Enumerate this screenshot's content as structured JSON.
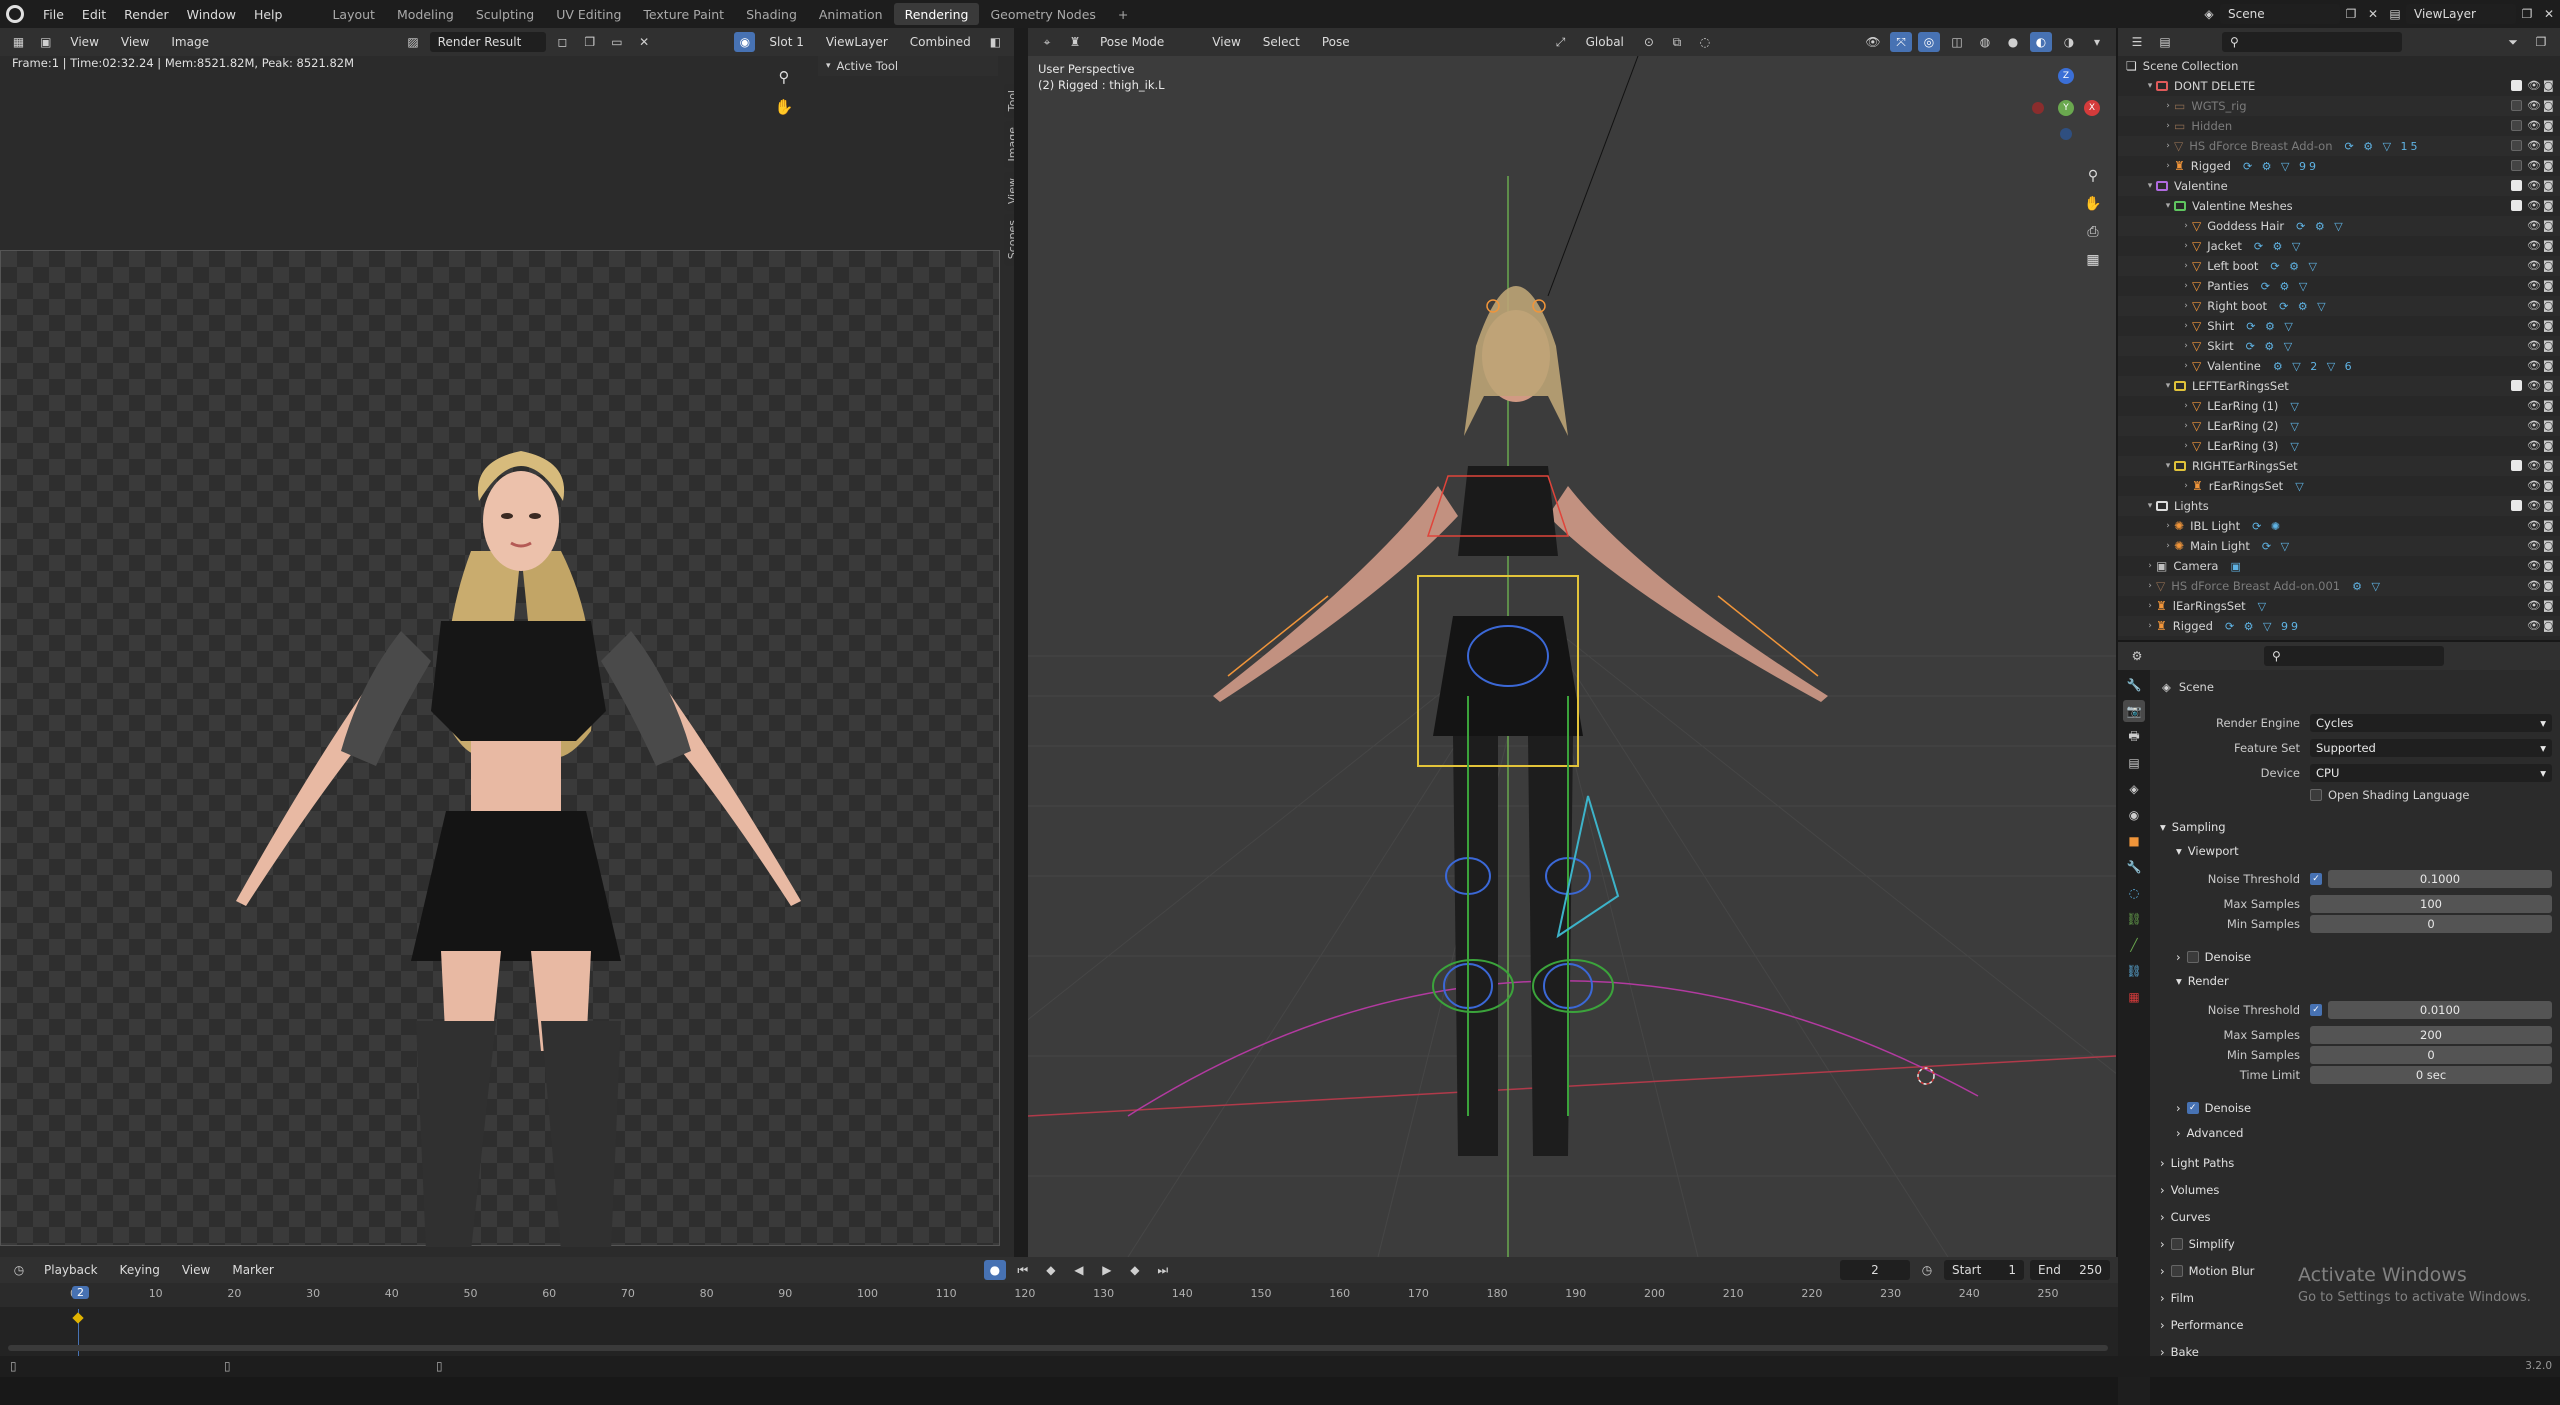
{
  "topbar": {
    "menus": [
      "File",
      "Edit",
      "Render",
      "Window",
      "Help"
    ],
    "workspaces": [
      "Layout",
      "Modeling",
      "Sculpting",
      "UV Editing",
      "Texture Paint",
      "Shading",
      "Animation",
      "Rendering",
      "Geometry Nodes"
    ],
    "active_workspace": "Rendering",
    "add_tab": "+",
    "scene": "Scene",
    "view_layer": "ViewLayer"
  },
  "image_editor": {
    "view": "View",
    "view2": "View",
    "image": "Image",
    "render_result": "Render Result",
    "slot": "Slot 1",
    "layer": "ViewLayer",
    "pass": "Combined",
    "info": "Frame:1 | Time:02:32.24 | Mem:8521.82M, Peak: 8521.82M",
    "active_tool": "Active Tool",
    "side_tabs": [
      "Tool",
      "Image",
      "View",
      "Scopes"
    ]
  },
  "viewport": {
    "mode": "Pose Mode",
    "menus": [
      "View",
      "Select",
      "Pose"
    ],
    "orientation": "Global",
    "overlay_title": "User Perspective",
    "overlay_sub": "(2) Rigged : thigh_ik.L",
    "gizmo_z": "Z",
    "gizmo_y": "Y",
    "gizmo_x": "X"
  },
  "outliner": {
    "search_placeholder": "",
    "root": "Scene Collection",
    "rows": [
      {
        "indent": 1,
        "label": "DONT DELETE",
        "type": "coll-red",
        "check": true
      },
      {
        "indent": 2,
        "label": "WGTS_rig",
        "type": "dim",
        "check": false
      },
      {
        "indent": 2,
        "label": "Hidden",
        "type": "dim",
        "check": false
      },
      {
        "indent": 2,
        "label": "HS dForce Breast Add-on",
        "type": "dim-mesh",
        "check": false,
        "mods": "⟳ ⚙ ▽ 15"
      },
      {
        "indent": 2,
        "label": "Rigged",
        "type": "armature",
        "check": false,
        "mods": "⟳ ⚙ ▽ 99"
      },
      {
        "indent": 1,
        "label": "Valentine",
        "type": "coll-purple",
        "check": true
      },
      {
        "indent": 2,
        "label": "Valentine  Meshes",
        "type": "coll-green",
        "check": true
      },
      {
        "indent": 3,
        "label": "Goddess Hair",
        "type": "mesh",
        "mods": "⟳ ⚙ ▽"
      },
      {
        "indent": 3,
        "label": "Jacket",
        "type": "mesh",
        "mods": "⟳ ⚙ ▽"
      },
      {
        "indent": 3,
        "label": "Left boot",
        "type": "mesh",
        "mods": "⟳ ⚙ ▽"
      },
      {
        "indent": 3,
        "label": "Panties",
        "type": "mesh",
        "mods": "⟳ ⚙ ▽"
      },
      {
        "indent": 3,
        "label": "Right boot",
        "type": "mesh",
        "mods": "⟳ ⚙ ▽"
      },
      {
        "indent": 3,
        "label": "Shirt",
        "type": "mesh",
        "mods": "⟳ ⚙ ▽"
      },
      {
        "indent": 3,
        "label": "Skirt",
        "type": "mesh",
        "mods": "⟳ ⚙ ▽"
      },
      {
        "indent": 3,
        "label": "Valentine",
        "type": "mesh",
        "mods": "⚙ ▽ 2 ▽ 6"
      },
      {
        "indent": 2,
        "label": "LEFTEarRingsSet",
        "type": "coll-yellow",
        "check": true
      },
      {
        "indent": 3,
        "label": "LEarRing (1)",
        "type": "mesh",
        "mods": "▽"
      },
      {
        "indent": 3,
        "label": "LEarRing (2)",
        "type": "mesh",
        "mods": "▽"
      },
      {
        "indent": 3,
        "label": "LEarRing (3)",
        "type": "mesh",
        "mods": "▽"
      },
      {
        "indent": 2,
        "label": "RIGHTEarRingsSet",
        "type": "coll-yellow",
        "check": true
      },
      {
        "indent": 3,
        "label": "rEarRingsSet",
        "type": "armature",
        "mods": "▽"
      },
      {
        "indent": 1,
        "label": "Lights",
        "type": "coll-white",
        "check": true
      },
      {
        "indent": 2,
        "label": "IBL Light",
        "type": "light",
        "mods": "⟳ ✺"
      },
      {
        "indent": 2,
        "label": "Main Light",
        "type": "light",
        "mods": "⟳ ▽"
      },
      {
        "indent": 1,
        "label": "Camera",
        "type": "camera",
        "mods": "▣"
      },
      {
        "indent": 1,
        "label": "HS dForce Breast Add-on.001",
        "type": "dim-mesh",
        "mods": "⚙ ▽"
      },
      {
        "indent": 1,
        "label": "lEarRingsSet",
        "type": "armature",
        "mods": "▽"
      },
      {
        "indent": 1,
        "label": "Rigged",
        "type": "armature",
        "mods": "⟳ ⚙ ▽ 99"
      }
    ]
  },
  "properties": {
    "breadcrumb": "Scene",
    "render_engine_label": "Render Engine",
    "render_engine": "Cycles",
    "feature_set_label": "Feature Set",
    "feature_set": "Supported",
    "device_label": "Device",
    "device": "CPU",
    "osl_label": "Open Shading Language",
    "sampling": "Sampling",
    "viewport": "Viewport",
    "noise_threshold_label": "Noise Threshold",
    "vp_noise": "0.1000",
    "max_samples_label": "Max Samples",
    "vp_max": "100",
    "min_samples_label": "Min Samples",
    "vp_min": "0",
    "denoise": "Denoise",
    "render": "Render",
    "r_noise": "0.0100",
    "r_max": "200",
    "r_min": "0",
    "time_limit_label": "Time Limit",
    "time_limit": "0 sec",
    "denoise2": "Denoise",
    "advanced": "Advanced",
    "panels": [
      "Light Paths",
      "Volumes",
      "Curves",
      "Simplify",
      "Motion Blur",
      "Film",
      "Performance",
      "Bake"
    ],
    "watermark1": "Activate Windows",
    "watermark2": "Go to Settings to activate Windows."
  },
  "timeline": {
    "menus": [
      "Playback",
      "Keying",
      "View",
      "Marker"
    ],
    "current_frame": "2",
    "start_label": "Start",
    "start": "1",
    "end_label": "End",
    "end": "250",
    "ticks": [
      "0",
      "10",
      "20",
      "30",
      "40",
      "50",
      "60",
      "70",
      "80",
      "90",
      "100",
      "110",
      "120",
      "130",
      "140",
      "150",
      "160",
      "170",
      "180",
      "190",
      "200",
      "210",
      "220",
      "230",
      "240",
      "250"
    ],
    "playhead": "2"
  },
  "status": {
    "version": "3.2.0"
  }
}
